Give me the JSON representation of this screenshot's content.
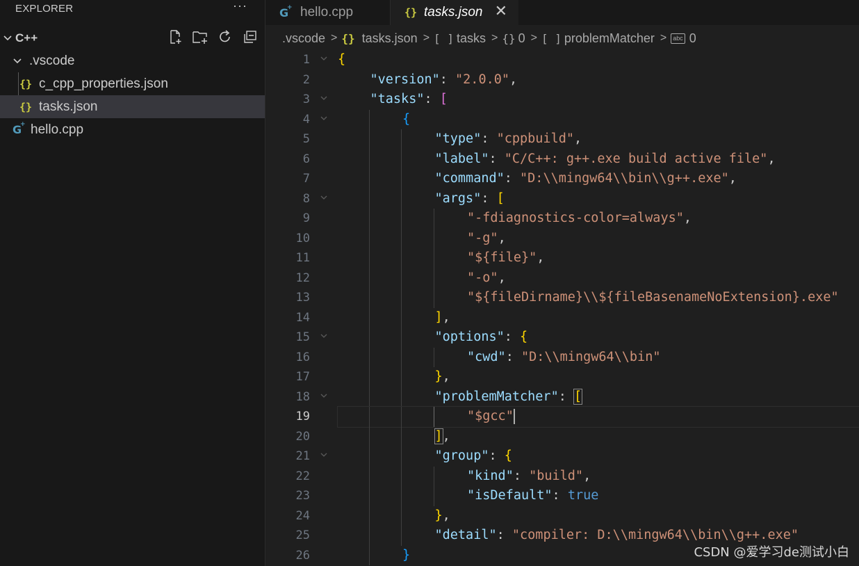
{
  "sidebar": {
    "title": "EXPLORER",
    "more": "···",
    "root": "C++",
    "items": [
      {
        "label": ".vscode",
        "type": "folder"
      },
      {
        "label": "c_cpp_properties.json",
        "type": "json",
        "icon": "{}"
      },
      {
        "label": "tasks.json",
        "type": "json",
        "icon": "{}",
        "selected": true
      },
      {
        "label": "hello.cpp",
        "type": "cpp",
        "icon": "G"
      }
    ]
  },
  "tabs": [
    {
      "label": "hello.cpp",
      "active": false
    },
    {
      "label": "tasks.json",
      "active": true,
      "close": "✕"
    }
  ],
  "breadcrumb": [
    ".vscode",
    "tasks.json",
    "tasks",
    "0",
    "problemMatcher",
    "0"
  ],
  "editor": {
    "active_line": 19,
    "lines": [
      {
        "n": 1,
        "fold": true,
        "indent": 0,
        "tokens": [
          [
            "b1",
            "{"
          ]
        ]
      },
      {
        "n": 2,
        "indent": 1,
        "tokens": [
          [
            "key",
            "\"version\""
          ],
          [
            "pun",
            ": "
          ],
          [
            "str",
            "\"2.0.0\""
          ],
          [
            "pun",
            ","
          ]
        ]
      },
      {
        "n": 3,
        "fold": true,
        "indent": 1,
        "tokens": [
          [
            "key",
            "\"tasks\""
          ],
          [
            "pun",
            ": "
          ],
          [
            "b2",
            "["
          ]
        ]
      },
      {
        "n": 4,
        "fold": true,
        "indent": 2,
        "tokens": [
          [
            "b3",
            "{"
          ]
        ]
      },
      {
        "n": 5,
        "indent": 3,
        "tokens": [
          [
            "key",
            "\"type\""
          ],
          [
            "pun",
            ": "
          ],
          [
            "str",
            "\"cppbuild\""
          ],
          [
            "pun",
            ","
          ]
        ]
      },
      {
        "n": 6,
        "indent": 3,
        "tokens": [
          [
            "key",
            "\"label\""
          ],
          [
            "pun",
            ": "
          ],
          [
            "str",
            "\"C/C++: g++.exe build active file\""
          ],
          [
            "pun",
            ","
          ]
        ]
      },
      {
        "n": 7,
        "indent": 3,
        "tokens": [
          [
            "key",
            "\"command\""
          ],
          [
            "pun",
            ": "
          ],
          [
            "str",
            "\"D:\\\\mingw64\\\\bin\\\\g++.exe\""
          ],
          [
            "pun",
            ","
          ]
        ]
      },
      {
        "n": 8,
        "fold": true,
        "indent": 3,
        "tokens": [
          [
            "key",
            "\"args\""
          ],
          [
            "pun",
            ": "
          ],
          [
            "b1",
            "["
          ]
        ]
      },
      {
        "n": 9,
        "indent": 4,
        "tokens": [
          [
            "str",
            "\"-fdiagnostics-color=always\""
          ],
          [
            "pun",
            ","
          ]
        ]
      },
      {
        "n": 10,
        "indent": 4,
        "tokens": [
          [
            "str",
            "\"-g\""
          ],
          [
            "pun",
            ","
          ]
        ]
      },
      {
        "n": 11,
        "indent": 4,
        "tokens": [
          [
            "str",
            "\"${file}\""
          ],
          [
            "pun",
            ","
          ]
        ]
      },
      {
        "n": 12,
        "indent": 4,
        "tokens": [
          [
            "str",
            "\"-o\""
          ],
          [
            "pun",
            ","
          ]
        ]
      },
      {
        "n": 13,
        "indent": 4,
        "tokens": [
          [
            "str",
            "\"${fileDirname}\\\\${fileBasenameNoExtension}.exe\""
          ]
        ]
      },
      {
        "n": 14,
        "indent": 3,
        "tokens": [
          [
            "b1",
            "]"
          ],
          [
            "pun",
            ","
          ]
        ]
      },
      {
        "n": 15,
        "fold": true,
        "indent": 3,
        "tokens": [
          [
            "key",
            "\"options\""
          ],
          [
            "pun",
            ": "
          ],
          [
            "b1",
            "{"
          ]
        ]
      },
      {
        "n": 16,
        "indent": 4,
        "tokens": [
          [
            "key",
            "\"cwd\""
          ],
          [
            "pun",
            ": "
          ],
          [
            "str",
            "\"D:\\\\mingw64\\\\bin\""
          ]
        ]
      },
      {
        "n": 17,
        "indent": 3,
        "tokens": [
          [
            "b1",
            "}"
          ],
          [
            "pun",
            ","
          ]
        ]
      },
      {
        "n": 18,
        "fold": true,
        "indent": 3,
        "tokens": [
          [
            "key",
            "\"problemMatcher\""
          ],
          [
            "pun",
            ": "
          ],
          [
            "b1m",
            "["
          ]
        ]
      },
      {
        "n": 19,
        "indent": 4,
        "tokens": [
          [
            "str",
            "\"$gcc\""
          ],
          [
            "cursor",
            ""
          ]
        ]
      },
      {
        "n": 20,
        "indent": 3,
        "tokens": [
          [
            "b1m",
            "]"
          ],
          [
            "pun",
            ","
          ]
        ]
      },
      {
        "n": 21,
        "fold": true,
        "indent": 3,
        "tokens": [
          [
            "key",
            "\"group\""
          ],
          [
            "pun",
            ": "
          ],
          [
            "b1",
            "{"
          ]
        ]
      },
      {
        "n": 22,
        "indent": 4,
        "tokens": [
          [
            "key",
            "\"kind\""
          ],
          [
            "pun",
            ": "
          ],
          [
            "str",
            "\"build\""
          ],
          [
            "pun",
            ","
          ]
        ]
      },
      {
        "n": 23,
        "indent": 4,
        "tokens": [
          [
            "key",
            "\"isDefault\""
          ],
          [
            "pun",
            ": "
          ],
          [
            "bool",
            "true"
          ]
        ]
      },
      {
        "n": 24,
        "indent": 3,
        "tokens": [
          [
            "b1",
            "}"
          ],
          [
            "pun",
            ","
          ]
        ]
      },
      {
        "n": 25,
        "indent": 3,
        "tokens": [
          [
            "key",
            "\"detail\""
          ],
          [
            "pun",
            ": "
          ],
          [
            "str",
            "\"compiler: D:\\\\mingw64\\\\bin\\\\g++.exe\""
          ]
        ]
      },
      {
        "n": 26,
        "indent": 2,
        "tokens": [
          [
            "b3",
            "}"
          ]
        ]
      }
    ]
  },
  "watermark": "CSDN @爱学习de测试小白"
}
